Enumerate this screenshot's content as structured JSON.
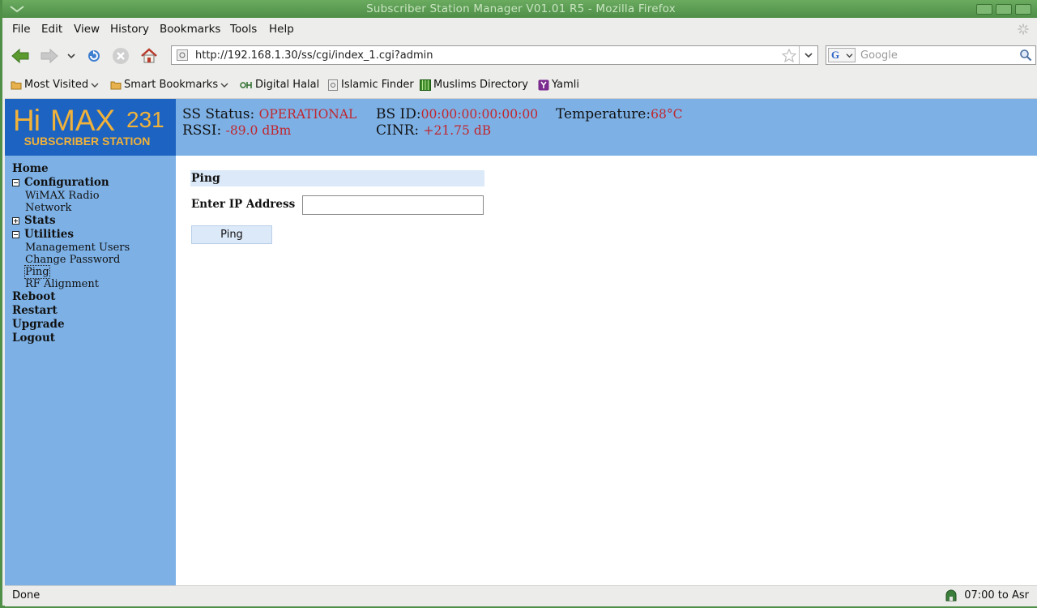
{
  "window": {
    "title": "Subscriber Station Manager V01.01 R5 - Mozilla Firefox"
  },
  "menu": {
    "file": "File",
    "edit": "Edit",
    "view": "View",
    "history": "History",
    "bookmarks": "Bookmarks",
    "tools": "Tools",
    "help": "Help"
  },
  "navbar": {
    "url": "http://192.168.1.30/ss/cgi/index_1.cgi?admin",
    "search_placeholder": "Google"
  },
  "bookmarks": [
    {
      "label": "Most Visited",
      "icon": "folder-icon",
      "dropdown": true
    },
    {
      "label": "Smart Bookmarks",
      "icon": "folder-icon",
      "dropdown": true
    },
    {
      "label": "Digital Halal",
      "icon": "dh-icon"
    },
    {
      "label": "Islamic Finder",
      "icon": "page-icon"
    },
    {
      "label": "Muslims Directory",
      "icon": "grid-icon"
    },
    {
      "label": "Yamli",
      "icon": "yamli-icon"
    }
  ],
  "logo": {
    "brand_hi": "Hi",
    "brand_max": "MAX",
    "model": "231",
    "subtitle": "SUBSCRIBER STATION"
  },
  "status": {
    "ss_status_label": "SS Status:",
    "ss_status_value": "OPERATIONAL",
    "bs_id_label": "BS ID:",
    "bs_id_value": "00:00:00:00:00:00",
    "temperature_label": "Temperature:",
    "temperature_value": "68°C",
    "rssi_label": "RSSI:",
    "rssi_value": "-89.0 dBm",
    "cinr_label": "CINR:",
    "cinr_value": "+21.75 dB"
  },
  "sidebar": {
    "home": "Home",
    "configuration": "Configuration",
    "wimax_radio": "WiMAX Radio",
    "network": "Network",
    "stats": "Stats",
    "utilities": "Utilities",
    "management_users": "Management Users",
    "change_password": "Change Password",
    "ping": "Ping",
    "rf_alignment": "RF Alignment",
    "reboot": "Reboot",
    "restart": "Restart",
    "upgrade": "Upgrade",
    "logout": "Logout"
  },
  "main": {
    "section_title": "Ping",
    "ip_label": "Enter IP Address",
    "ip_value": "",
    "ping_button": "Ping"
  },
  "statusbar": {
    "text": "Done",
    "prayer": "07:00 to Asr"
  },
  "colors": {
    "title_bar": "#4e8e47",
    "header_blue": "#7db1e6",
    "logo_blue": "#1c63c2",
    "logo_orange": "#f0b23a",
    "value_red": "#c0262d"
  }
}
